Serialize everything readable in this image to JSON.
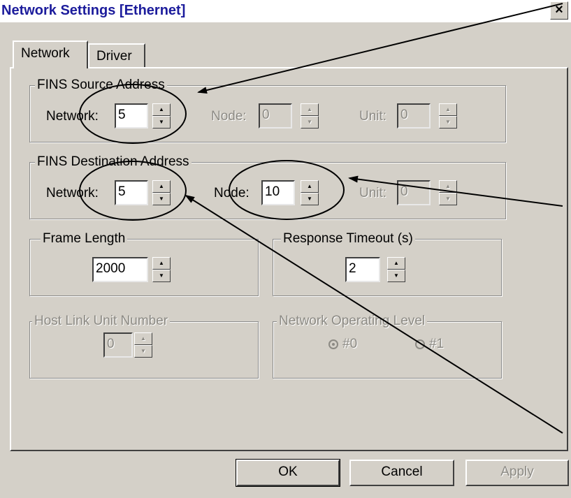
{
  "window": {
    "title": "Network Settings [Ethernet]",
    "close_symbol": "×"
  },
  "tabs": [
    {
      "label": "Network",
      "active": true
    },
    {
      "label": "Driver",
      "active": false
    }
  ],
  "fins_source": {
    "legend": "FINS Source Address",
    "network_label": "Network:",
    "network_value": "5",
    "node_label": "Node:",
    "node_value": "0",
    "unit_label": "Unit:",
    "unit_value": "0"
  },
  "fins_destination": {
    "legend": "FINS Destination Address",
    "network_label": "Network:",
    "network_value": "5",
    "node_label": "Node:",
    "node_value": "10",
    "unit_label": "Unit:",
    "unit_value": "0"
  },
  "frame_length": {
    "legend": "Frame Length",
    "value": "2000"
  },
  "response_timeout": {
    "legend": "Response Timeout (s)",
    "value": "2"
  },
  "host_link": {
    "legend": "Host Link Unit Number",
    "value": "0"
  },
  "operating_level": {
    "legend": "Network Operating Level",
    "option1": "#0",
    "option2": "#1",
    "selected": "#0"
  },
  "buttons": {
    "ok": "OK",
    "cancel": "Cancel",
    "apply": "Apply"
  },
  "icons": {
    "spin_up": "▲",
    "spin_down": "▼"
  },
  "colors": {
    "dialog_bg": "#d4d0c8",
    "title_text": "#1c1c9c",
    "disabled_text": "#8c8a84"
  }
}
